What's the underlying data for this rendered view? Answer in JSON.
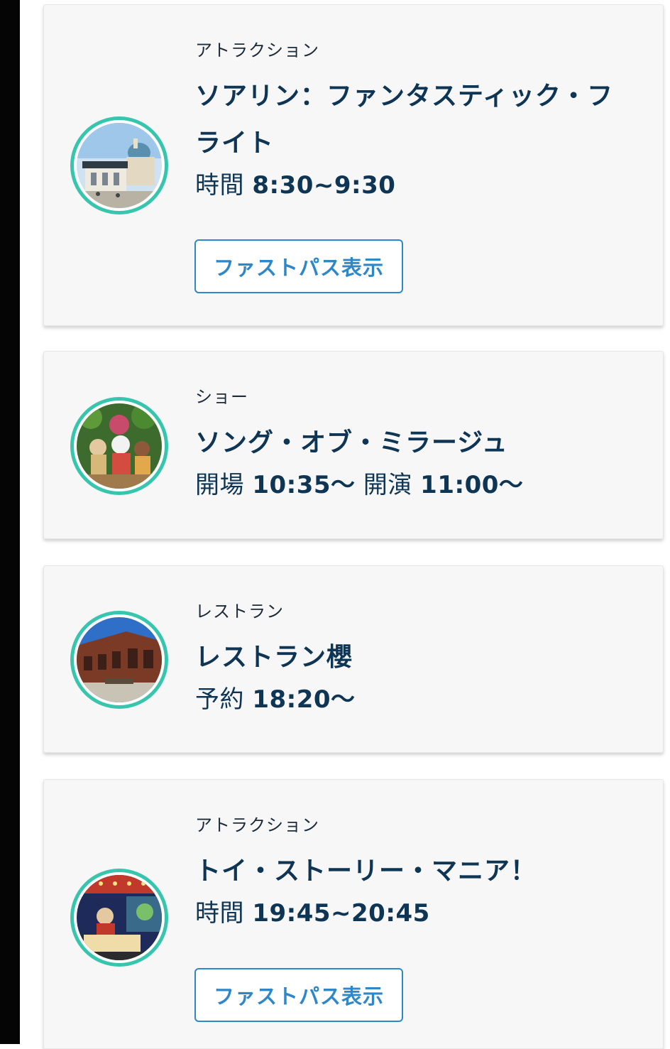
{
  "items": [
    {
      "category": "アトラクション",
      "title_lines": [
        "ソアリン：ファンタスティック・フ",
        "ライト"
      ],
      "time_label": "時間",
      "time_value": "8:30~9:30",
      "button_label": "ファストパス表示",
      "thumb_icon": "attraction-building-photo"
    },
    {
      "category": "ショー",
      "title_lines": [
        "ソング・オブ・ミラージュ"
      ],
      "time_label": "開場",
      "time_value": "10:35〜",
      "time_label_2": "開演",
      "time_value_2": "11:00〜",
      "thumb_icon": "show-characters-photo"
    },
    {
      "category": "レストラン",
      "title_lines": [
        "レストラン櫻"
      ],
      "time_label": "予約",
      "time_value": "18:20〜",
      "thumb_icon": "restaurant-building-photo"
    },
    {
      "category": "アトラクション",
      "title_lines": [
        "トイ・ストーリー・マニア！"
      ],
      "time_label": "時間",
      "time_value": "19:45~20:45",
      "button_label": "ファストパス表示",
      "thumb_icon": "ride-vehicle-photo"
    }
  ],
  "colors": {
    "accent_ring": "#37c6ad",
    "title_text": "#0f3554",
    "button_blue": "#2d87c8",
    "card_bg": "#f7f7f7"
  }
}
